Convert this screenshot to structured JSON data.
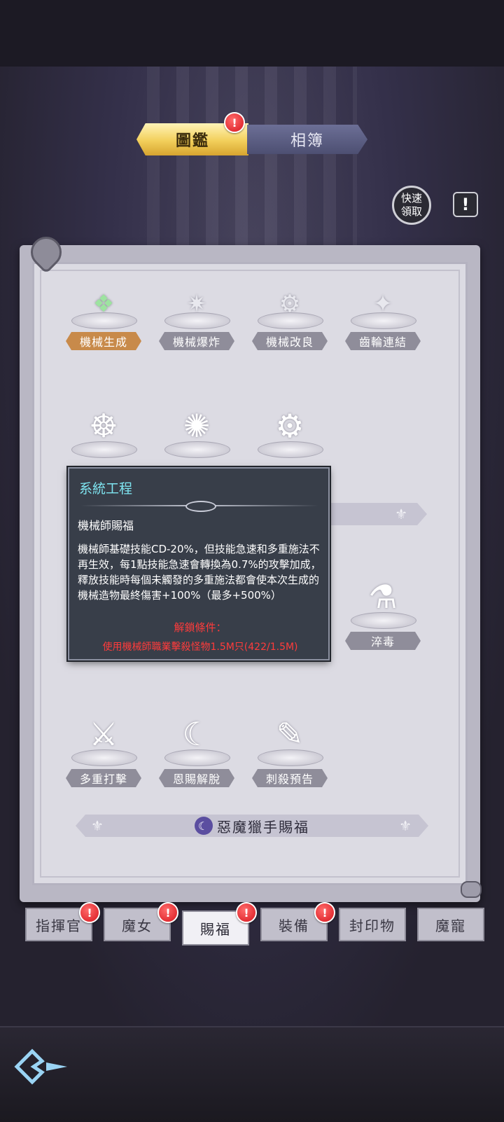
{
  "top_tabs": {
    "gallery": "圖鑑",
    "match": "相簿"
  },
  "quick_claim": "快速\n領取",
  "warning_glyph": "!",
  "alert_glyph": "!",
  "top_skills": [
    {
      "label": "機械生成",
      "active": true,
      "icon": "mech-generate-icon",
      "glyph": "❖"
    },
    {
      "label": "機械爆炸",
      "active": false,
      "icon": "mech-explosion-icon",
      "glyph": "✷"
    },
    {
      "label": "機械改良",
      "active": false,
      "icon": "mech-upgrade-icon",
      "glyph": "⚙"
    },
    {
      "label": "齒輪連結",
      "active": false,
      "icon": "gear-link-icon",
      "glyph": "✦"
    }
  ],
  "mid_icons": [
    {
      "icon": "mech-spider-icon",
      "glyph": "☸"
    },
    {
      "icon": "drill-icon",
      "glyph": "✺"
    },
    {
      "icon": "gear-box-icon",
      "glyph": "⚙"
    }
  ],
  "poison_skill": {
    "label": "淬毒",
    "icon": "poison-dagger-icon",
    "glyph": "⚗"
  },
  "bottom_skills": [
    {
      "label": "多重打擊",
      "icon": "multi-strike-icon",
      "glyph": "⚔"
    },
    {
      "label": "恩賜解脫",
      "icon": "grace-release-icon",
      "glyph": "☾"
    },
    {
      "label": "刺殺預告",
      "icon": "assassination-notice-icon",
      "glyph": "✎"
    }
  ],
  "section_title": "惡魔獵手賜福",
  "tooltip": {
    "title": "系統工程",
    "subtitle": "機械師賜福",
    "description": "機械師基礎技能CD-20%，但技能急速和多重施法不再生效，每1點技能急速會轉換為0.7%的攻擊加成，釋放技能時每個未觸發的多重施法都會使本次生成的機械造物最終傷害+100%（最多+500%）",
    "condition_header": "解鎖條件：",
    "condition": "使用機械師職業擊殺怪物1.5M只(422/1.5M)"
  },
  "bottom_tabs": [
    {
      "label": "指揮官",
      "alert": true,
      "active": false
    },
    {
      "label": "魔女",
      "alert": true,
      "active": false
    },
    {
      "label": "賜福",
      "alert": true,
      "active": true
    },
    {
      "label": "裝備",
      "alert": true,
      "active": false
    },
    {
      "label": "封印物",
      "alert": false,
      "active": false
    },
    {
      "label": "魔寵",
      "alert": false,
      "active": false
    }
  ],
  "colors": {
    "accent_gold": "#f2cf5a",
    "tooltip_title": "#7fe6f2",
    "condition_red": "#ff3b3b",
    "active_label": "#c88a4a"
  }
}
